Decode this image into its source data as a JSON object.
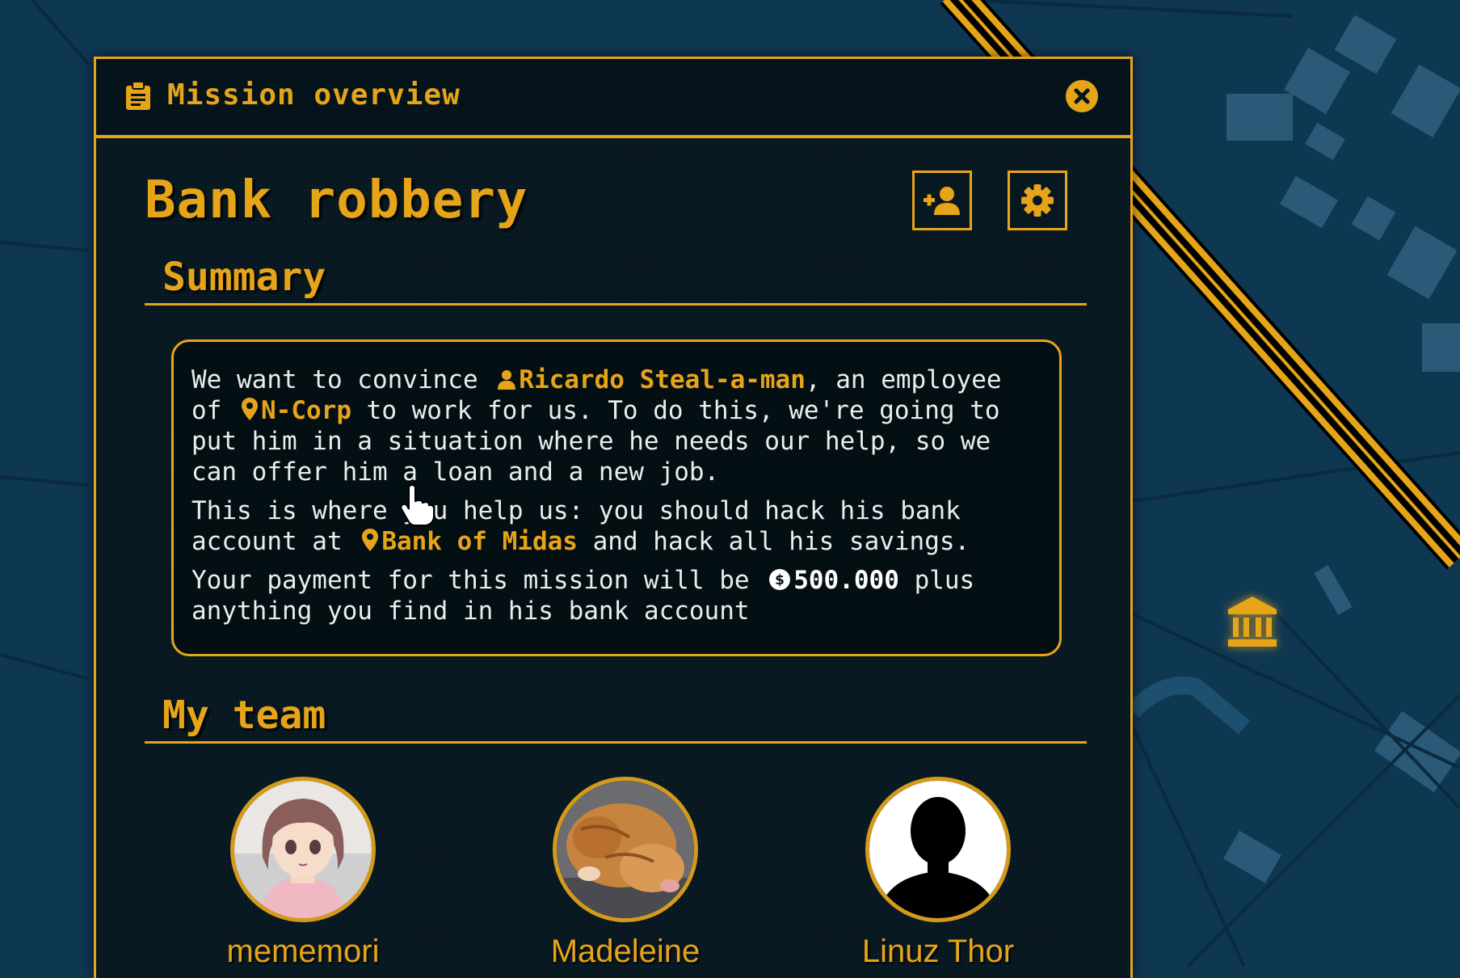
{
  "window": {
    "title": "Mission overview",
    "icon": "clipboard-icon",
    "close_icon": "close-icon"
  },
  "mission": {
    "title": "Bank robbery",
    "actions": [
      {
        "name": "add-member",
        "icon": "user-plus-icon"
      },
      {
        "name": "settings",
        "icon": "gear-icon"
      }
    ]
  },
  "summary": {
    "heading": "Summary",
    "p1": {
      "t1": "We want to convince",
      "person": "Ricardo Steal-a-man",
      "t2": ", an employee",
      "t3": "of",
      "company": "N-Corp",
      "t4": "to work for us. To do this, we're going to",
      "t5": "put him in a situation where he needs our help, so we",
      "t6": "can offer him a loan and a new job."
    },
    "p2": {
      "t1": "This is where you help us: you should hack his bank",
      "t2": "account at",
      "location": "Bank of Midas",
      "t3": "and hack all his savings."
    },
    "p3": {
      "t1": "Your payment for this mission will be",
      "amount": "500.000",
      "t2": "plus",
      "t3": "anything you find in his bank account"
    }
  },
  "team": {
    "heading": "My team",
    "members": [
      {
        "name": "mememori",
        "avatar": "anime-girl-avatar"
      },
      {
        "name": "Madeleine",
        "avatar": "cat-photo-avatar"
      },
      {
        "name": "Linuz Thor",
        "avatar": "silhouette-avatar"
      }
    ]
  },
  "map": {
    "marker": "bank-icon",
    "accent": "#e6a419",
    "background": "#0e3752"
  }
}
